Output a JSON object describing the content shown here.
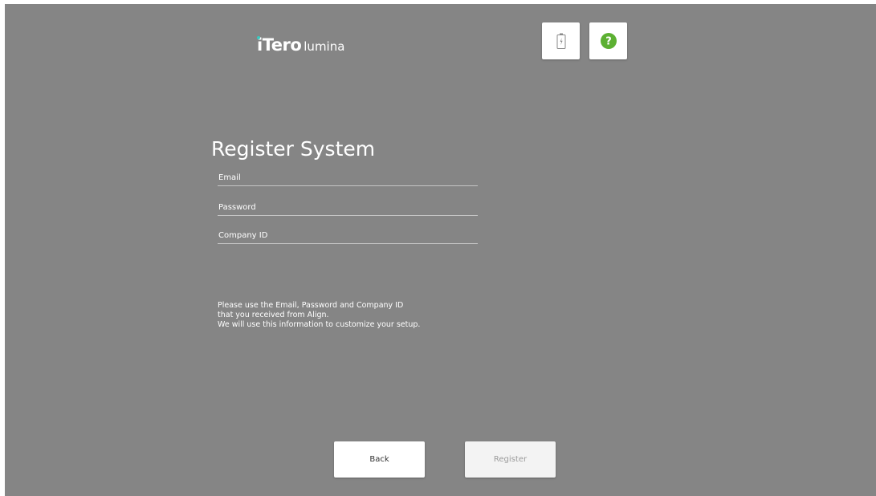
{
  "app": {
    "logo_mark": "iTero",
    "logo_sub": "lumina"
  },
  "toolbar": {
    "battery_icon": "battery-charging-icon",
    "help_icon": "help-icon"
  },
  "page": {
    "title": "Register System"
  },
  "form": {
    "email": {
      "placeholder": "Email",
      "value": ""
    },
    "password": {
      "placeholder": "Password",
      "value": ""
    },
    "company_id": {
      "placeholder": "Company ID",
      "value": ""
    }
  },
  "info": {
    "line1": "Please use the Email, Password and Company ID",
    "line2": "that you received from Align.",
    "line3": "We will use this information to customize your setup."
  },
  "actions": {
    "back_label": "Back",
    "register_label": "Register",
    "register_state": "disabled"
  },
  "colors": {
    "background": "#858585",
    "logo_accent": "#38c9c0",
    "help_green": "#5cb032"
  }
}
